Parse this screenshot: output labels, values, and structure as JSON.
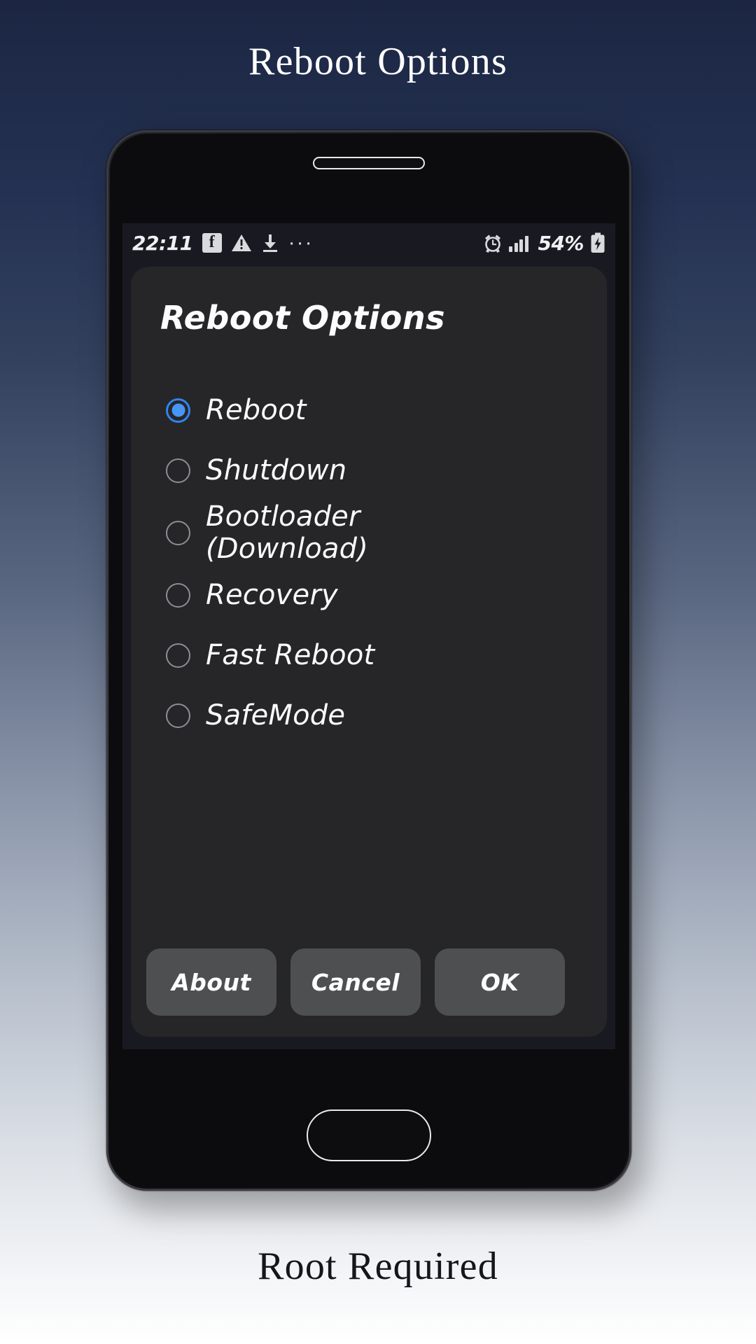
{
  "promo": {
    "title": "Reboot Options",
    "caption": "Root Required"
  },
  "status_bar": {
    "time": "22:11",
    "left_icons": [
      {
        "name": "facebook-icon",
        "glyph": "f"
      },
      {
        "name": "warning-triangle-icon"
      },
      {
        "name": "download-icon"
      },
      {
        "name": "more-notifications-icon",
        "glyph": "···"
      }
    ],
    "right_icons": [
      {
        "name": "alarm-clock-icon"
      },
      {
        "name": "signal-bars-icon"
      }
    ],
    "battery_percent": "54%",
    "battery_state": "charging"
  },
  "dialog": {
    "title": "Reboot Options",
    "selected_index": 0,
    "options": [
      {
        "label": "Reboot",
        "checked": true
      },
      {
        "label": "Shutdown",
        "checked": false
      },
      {
        "label": "Bootloader\n(Download)",
        "checked": false
      },
      {
        "label": "Recovery",
        "checked": false
      },
      {
        "label": "Fast Reboot",
        "checked": false
      },
      {
        "label": "SafeMode",
        "checked": false
      }
    ],
    "buttons": {
      "about": "About",
      "cancel": "Cancel",
      "ok": "OK"
    }
  },
  "colors": {
    "accent": "#4895f5",
    "accent_ring": "#2f84f0",
    "dialog_bg": "#262629",
    "screen_bg": "#191a21",
    "button_bg": "#4e4f51",
    "backdrop_top": "#1b2642",
    "backdrop_bottom": "#ffffff"
  }
}
